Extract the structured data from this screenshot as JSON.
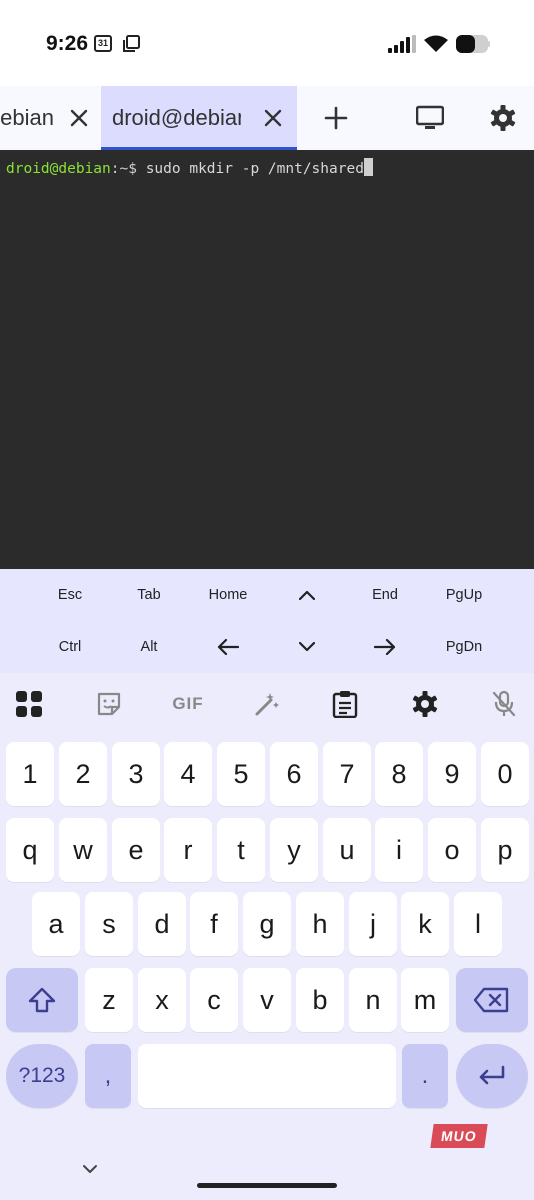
{
  "status_bar": {
    "time": "9:26",
    "calendar_day": "31",
    "icons": [
      "signal-icon",
      "wifi-icon",
      "battery-icon"
    ]
  },
  "tabs": [
    {
      "label": "droid@debian",
      "active": false
    },
    {
      "label": "droid@debian",
      "active": true
    }
  ],
  "toolbar_icons": [
    "add-tab-icon",
    "display-icon",
    "settings-icon"
  ],
  "terminal": {
    "prompt_user": "droid@debian",
    "prompt_sep": ":~$ ",
    "command": "sudo mkdir -p /mnt/shared"
  },
  "extra_keys": {
    "row1": [
      "Esc",
      "Tab",
      "Home",
      "^",
      "End",
      "PgUp"
    ],
    "row2": [
      "Ctrl",
      "Alt",
      "←",
      "⌄",
      "→",
      "PgDn"
    ]
  },
  "keyboard": {
    "toolbar": [
      "apps-grid-icon",
      "sticker-icon",
      "GIF",
      "magic-wand-icon",
      "clipboard-icon",
      "settings-icon",
      "mic-off-icon"
    ],
    "gif_label": "GIF",
    "number_row": [
      "1",
      "2",
      "3",
      "4",
      "5",
      "6",
      "7",
      "8",
      "9",
      "0"
    ],
    "row_q": [
      "q",
      "w",
      "e",
      "r",
      "t",
      "y",
      "u",
      "i",
      "o",
      "p"
    ],
    "row_a": [
      "a",
      "s",
      "d",
      "f",
      "g",
      "h",
      "j",
      "k",
      "l"
    ],
    "row_z": [
      "z",
      "x",
      "c",
      "v",
      "b",
      "n",
      "m"
    ],
    "symbols_label": "?123",
    "comma": ",",
    "period": ".",
    "accent_color": "#3b3f8f"
  },
  "watermark": "MUO"
}
